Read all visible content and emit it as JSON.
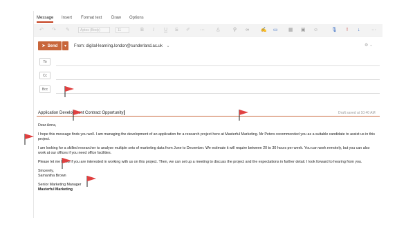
{
  "tabs": [
    "Message",
    "Insert",
    "Format text",
    "Draw",
    "Options"
  ],
  "toolbar": {
    "font_name": "Aptos (Body)",
    "font_size": "11",
    "icons": [
      "undo-icon",
      "redo-icon",
      "clipboard-icon",
      "bold-icon",
      "italic-icon",
      "underline-icon",
      "strikethrough-icon",
      "highlight-icon",
      "more-icon",
      "styles-icon",
      "attach-icon",
      "link-icon",
      "signature-icon",
      "table-icon",
      "picture-icon",
      "emoji-icon",
      "dictate-icon",
      "priority-icon",
      "low-priority-icon",
      "more-options-icon"
    ]
  },
  "send": {
    "label": "Send"
  },
  "from": {
    "label": "From:",
    "address": "digital-learning.london@sunderland.ac.uk"
  },
  "fields": {
    "to": "To",
    "cc": "Cc",
    "bcc": "Bcc"
  },
  "subject": "Application Development Contract Opportunity",
  "draft_status": "Draft saved at 10:40 AM",
  "body": {
    "greeting": "Dear Anna,",
    "p1": "I hope this message finds you well. I am managing the development of an application for a research project here at Masterful Marketing. Mr Peters recommended you as a suitable candidate to assist us in this project.",
    "p2": "I am looking for a skilled researcher to analyse multiple sets of marketing data from June to December. We estimate it will require between 20 to 30 hours per week. You can work remotely, but you can also work at our offices if you need office facilities.",
    "p3": "Please let me know if you are interested in working with us on this project. Then, we can set up a meeting to discuss the project and the expectations in further detail. I look forward to hearing from you.",
    "closing": "Sincerely,",
    "name": "Samantha Brown",
    "title": "Senior Marketing Manager",
    "company": "Masterful Marketing"
  },
  "colors": {
    "accent": "#c8663b",
    "flag": "#e04040"
  }
}
